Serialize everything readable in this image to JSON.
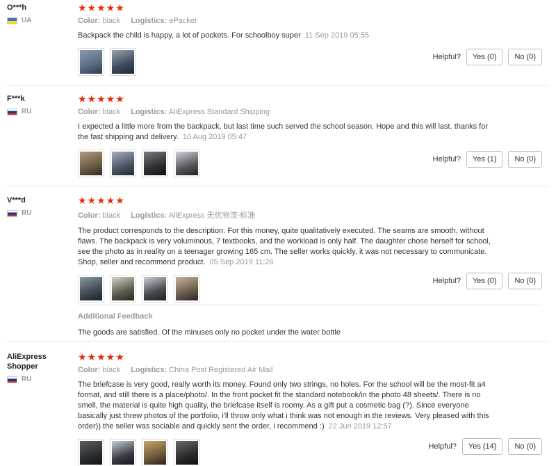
{
  "labels": {
    "color": "Color:",
    "logistics": "Logistics:",
    "helpful": "Helpful?",
    "stars": "★★★★★",
    "additional_feedback": "Additional Feedback"
  },
  "reviews": [
    {
      "user": "O***h",
      "country": "UA",
      "color": "black",
      "logistics": "ePacket",
      "rating": 5,
      "text": "Backpack the child is happy, a lot of pockets. For schoolboy super",
      "date": "11 Sep 2019 05:55",
      "thumb_colors": [
        "#5a6a80",
        "#3d4a5e"
      ],
      "yes": "Yes (0)",
      "no": "No (0)"
    },
    {
      "user": "F***k",
      "country": "RU",
      "color": "black",
      "logistics": "AliExpress Standard Shipping",
      "rating": 5,
      "text": "I expected a little more from the backpack, but last time such served the school season. Hope and this will last. thanks for the fast shipping and delivery.",
      "date": "10 Aug 2019 05:47",
      "thumb_colors": [
        "#6b5a44",
        "#4a5563",
        "#2f2f33",
        "#55575c"
      ],
      "yes": "Yes (1)",
      "no": "No (0)"
    },
    {
      "user": "V***d",
      "country": "RU",
      "color": "black",
      "logistics": "AliExpress 无忧物流-标准",
      "rating": 5,
      "text": "The product corresponds to the description. For this money, quite qualitatively executed. The seams are smooth, without flaws. The backpack is very voluminous, 7 textbooks, and the workload is only half. The daughter chose herself for school, see the photo as in reality on a teenager growing 165 cm. The seller works quickly, it was not necessary to communicate. Shop, seller and recommend product.",
      "date": "05 Sep 2019 11:26",
      "thumb_colors": [
        "#3e4a52",
        "#5e5a52",
        "#454a4f",
        "#6a5d4d"
      ],
      "yes": "Yes (0)",
      "no": "No (0)",
      "additional": "The goods are satisfied. Of the minuses only no pocket under the water bottle"
    },
    {
      "user": "AliExpress Shopper",
      "country": "RU",
      "color": "black",
      "logistics": "China Post Registered Air Mail",
      "rating": 5,
      "text": "The briefcase is very good, really worth its money. Found only two strings, no holes. For the school will be the most-fit a4 format, and still there is a place/photo/. In the front pocket fit the standard notebook/in the photo 48 sheets/. There is no smell, the material is quite high quality, the briefcase itself is roomy. As a gift put a cosmetic bag (?). Since everyone basically just threw photos of the portfolio, i'll throw only what i think was not enough in the reviews. Very pleased with this order)) the seller was sociable and quickly sent the order, i recommend :)",
      "date": "22 Jun 2019 12:57",
      "thumb_colors": [
        "#2b2d2f",
        "#3a3f45",
        "#6e5a3c",
        "#2a2a2a"
      ],
      "yes": "Yes (14)",
      "no": "No (0)"
    }
  ]
}
